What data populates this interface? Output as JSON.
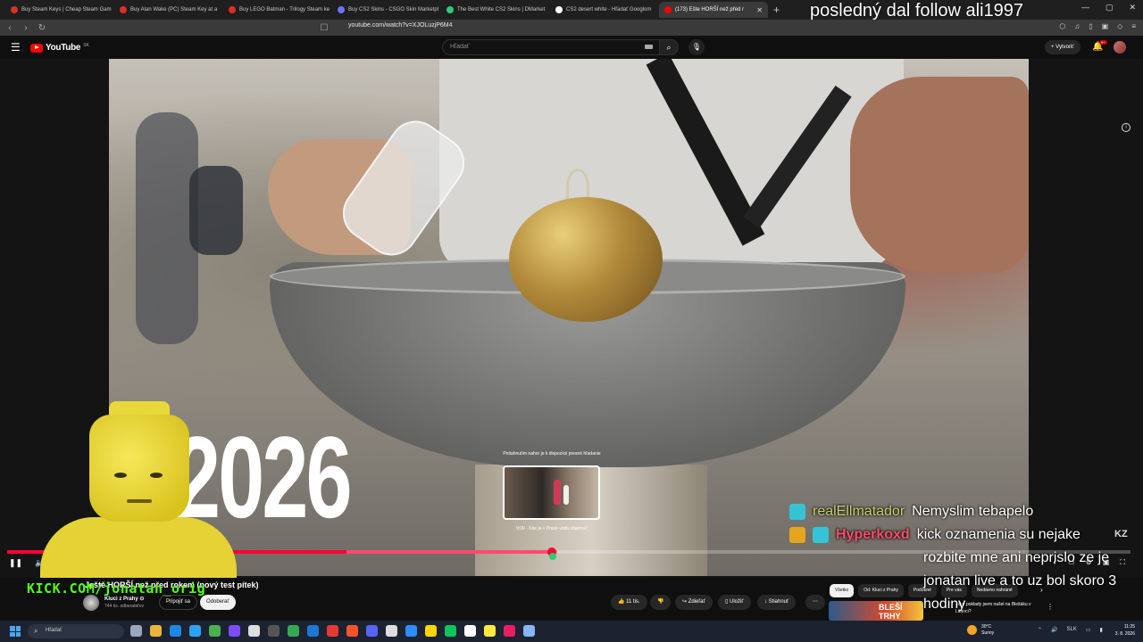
{
  "browser": {
    "tabs": [
      {
        "label": "Buy Steam Keys | Cheap Steam Gam",
        "color": "#d93025"
      },
      {
        "label": "Buy Alan Wake (PC) Steam Key at a",
        "color": "#d93025"
      },
      {
        "label": "Buy LEGO Batman - Trilogy Steam ke",
        "color": "#d93025"
      },
      {
        "label": "Buy CS2 Skins - CSGO Skin Marketpl",
        "color": "#6b74ff"
      },
      {
        "label": "The Best White CS2 Skins | DMarket",
        "color": "#2ecc71"
      },
      {
        "label": "CS2 desert white - Hľadať Googlom",
        "color": "#ffffff"
      },
      {
        "label": "(173) Ešte HORŠÍ než před r",
        "color": "#ff0000"
      }
    ],
    "new_tab": "+",
    "url": "youtube.com/watch?v=XJOLuzjP6M4"
  },
  "overlay": {
    "follow_text": "posledný dal follow ali1997",
    "kick_url": "KICK.COM/jonatan_orig"
  },
  "youtube": {
    "logo": "YouTube",
    "logo_region": "SK",
    "search_placeholder": "Hľadať",
    "create_label": "Vytvoriť",
    "notifications_badge": "9+"
  },
  "video": {
    "overlay_year": "2026",
    "progress_percent": 48.5,
    "buffer_percent": 50.2,
    "preview_title": "Potiahnutím nahor je k dispozícii presné hľadanie",
    "preview_time": "9:09 · Kde je v Praze voda zdarma?"
  },
  "chat": [
    {
      "user": "realEllmatador",
      "message": "Nemyslim tebapelo",
      "style": "normal",
      "badge": "cyan"
    },
    {
      "user": "Hyperkoxd",
      "message": "kick oznamenia su nejake",
      "style": "red",
      "badge": "gold"
    }
  ],
  "chat_continuation": [
    "rozbite mne ani neprislo ze je",
    "jonatan live a to uz bol skoro 3",
    "hodiny"
  ],
  "kz_logo": "KZ",
  "below": {
    "title": "Ještě HORŠÍ než před rokem (nový test pítek)",
    "channel_name": "Kluci z Prahy ⊙",
    "channel_subs": "744 tis. odberateľov",
    "join": "Pripojiť sa",
    "subscribe": "Odoberať",
    "likes": "11 tis.",
    "share": "Zdieľať",
    "save": "Uložiť",
    "download": "Stiahnuť",
    "more": "⋯"
  },
  "chips": [
    "Všetko",
    "Od: Kluci z Prahy",
    "Podobné",
    "Pre vás",
    "Nedávno nahrané"
  ],
  "recommended": {
    "thumb_text": "BLEŠÍ TRHY",
    "title": "Jaké poklady jsem našel na Blešáku v Liberci?"
  },
  "taskbar": {
    "search": "Hľadať",
    "weather_temp": "30°C",
    "weather_desc": "Sunny",
    "lang": "SLK",
    "time": "11:25",
    "date": "3. 8. 2026"
  }
}
